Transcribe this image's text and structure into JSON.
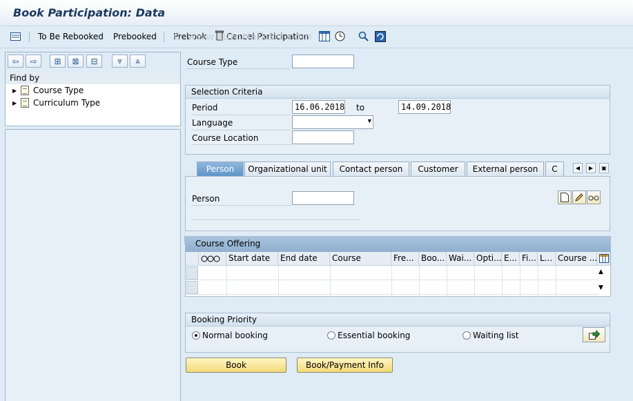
{
  "window": {
    "title": "Book Participation: Data"
  },
  "toolbar": {
    "items": [
      "To Be Rebooked",
      "Prebooked",
      "Prebook",
      "Cancel Participation"
    ]
  },
  "watermark": "© www.tutorialkart.com",
  "left_panel": {
    "find_by": "Find by",
    "tree": [
      "Course Type",
      "Curriculum Type"
    ]
  },
  "course_type": {
    "label": "Course Type",
    "value": ""
  },
  "selection": {
    "title": "Selection Criteria",
    "period_label": "Period",
    "period_from": "16.06.2018",
    "to_label": "to",
    "period_to": "14.09.2018",
    "language_label": "Language",
    "language_value": "",
    "location_label": "Course Location",
    "location_value": ""
  },
  "tabs": [
    "Person",
    "Organizational unit",
    "Contact person",
    "Customer",
    "External person",
    "C"
  ],
  "person": {
    "label": "Person",
    "value": ""
  },
  "offering": {
    "title": "Course Offering",
    "columns": [
      "Start date",
      "End date",
      "Course",
      "Fre...",
      "Boo...",
      "Wai...",
      "Opti...",
      "E...",
      "Fi...",
      "L...",
      "Course ..."
    ]
  },
  "priority": {
    "title": "Booking Priority",
    "options": [
      "Normal booking",
      "Essential booking",
      "Waiting list"
    ],
    "selected": "Normal booking"
  },
  "buttons": {
    "book": "Book",
    "payment": "Book/Payment Info"
  },
  "colors": {
    "background": "#dfebf5",
    "active_tab": "#6a9fd0",
    "button": "#f3d978"
  }
}
